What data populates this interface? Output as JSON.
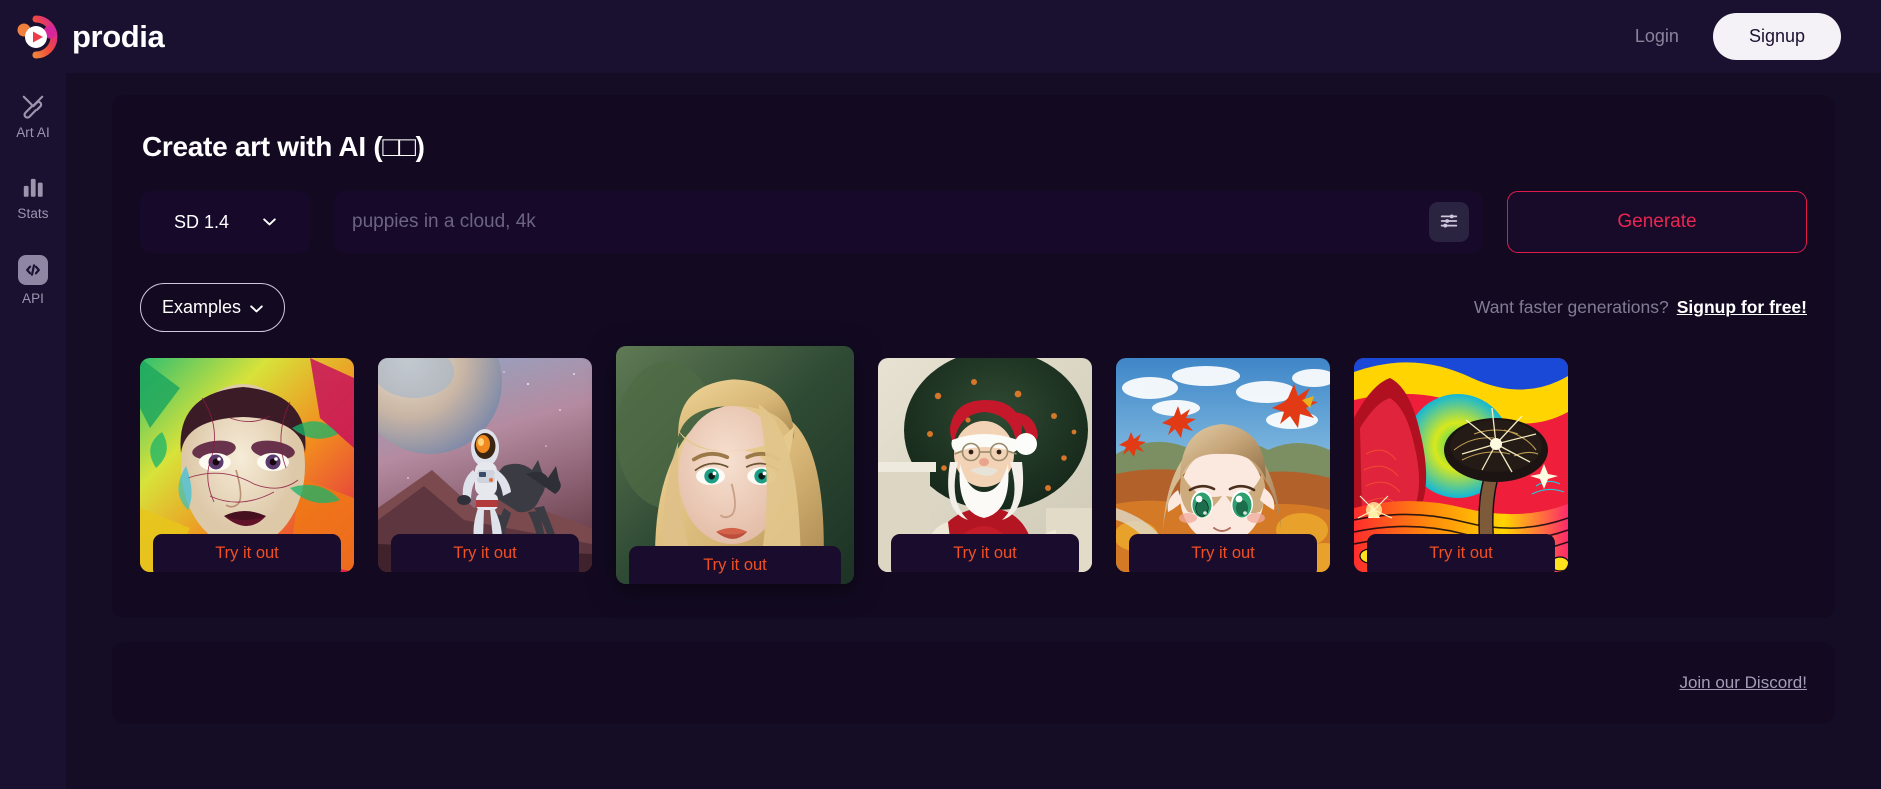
{
  "header": {
    "brand_name": "prodia",
    "logo_icon": "play-circle-gradient-icon",
    "login_label": "Login",
    "signup_label": "Signup"
  },
  "sidebar": {
    "items": [
      {
        "label": "Art AI",
        "icon": "paintbrush-icon"
      },
      {
        "label": "Stats",
        "icon": "bar-chart-icon"
      },
      {
        "label": "API",
        "icon": "code-brackets-icon"
      }
    ]
  },
  "main": {
    "title": "Create art with AI (□□)",
    "model_select": {
      "value": "SD 1.4",
      "chevron_icon": "chevron-down-icon"
    },
    "prompt": {
      "value": "",
      "placeholder": "puppies in a cloud, 4k"
    },
    "settings_icon": "sliders-icon",
    "generate_label": "Generate",
    "examples_label": "Examples",
    "examples_chevron_icon": "chevron-down-icon",
    "faster_text": "Want faster generations?",
    "faster_link": "Signup for free!",
    "try_label": "Try it out",
    "cards": [
      {
        "name": "colorful-painted-woman-portrait",
        "try_label": "Try it out",
        "featured": false
      },
      {
        "name": "astronaut-riding-horse",
        "try_label": "Try it out",
        "featured": false
      },
      {
        "name": "blonde-woman-photo-portrait",
        "try_label": "Try it out",
        "featured": true
      },
      {
        "name": "santa-claus-christmas-tree",
        "try_label": "Try it out",
        "featured": false
      },
      {
        "name": "anime-girl-autumn-leaves",
        "try_label": "Try it out",
        "featured": false
      },
      {
        "name": "psychedelic-tree-landscape",
        "try_label": "Try it out",
        "featured": false
      }
    ]
  },
  "footer": {
    "discord_label": "Join our Discord!"
  },
  "colors": {
    "page_bg": "#150c26",
    "header_bg": "#1a1130",
    "panel_bg": "#130a22",
    "field_bg": "#16092a",
    "accent_red": "#ea2552",
    "accent_orange": "#f24f23",
    "muted_text": "#837b96",
    "white": "#ffffff"
  }
}
